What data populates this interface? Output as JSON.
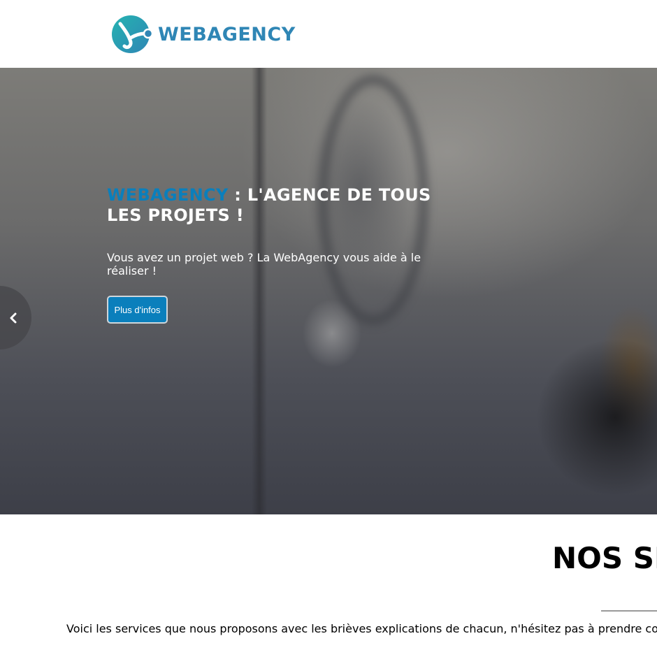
{
  "header": {
    "logo_text": "WEBAGENCY",
    "logo_colors": {
      "teal": "#25b3b1",
      "blue": "#2f86b5"
    }
  },
  "hero": {
    "title_accent": "WEBAGENCY",
    "title_rest": " : L'AGENCE DE TOUS LES PROJETS !",
    "text": "Vous avez un projet web ? La WebAgency vous aide à le réaliser !",
    "button_label": "Plus d'infos",
    "prev_icon": "chevron-left-icon",
    "accent_color": "#0a7fbc"
  },
  "services": {
    "title": "NOS SI",
    "description": "Voici les services que nous proposons avec les brièves explications de chacun, n'hésitez pas à prendre cor"
  }
}
